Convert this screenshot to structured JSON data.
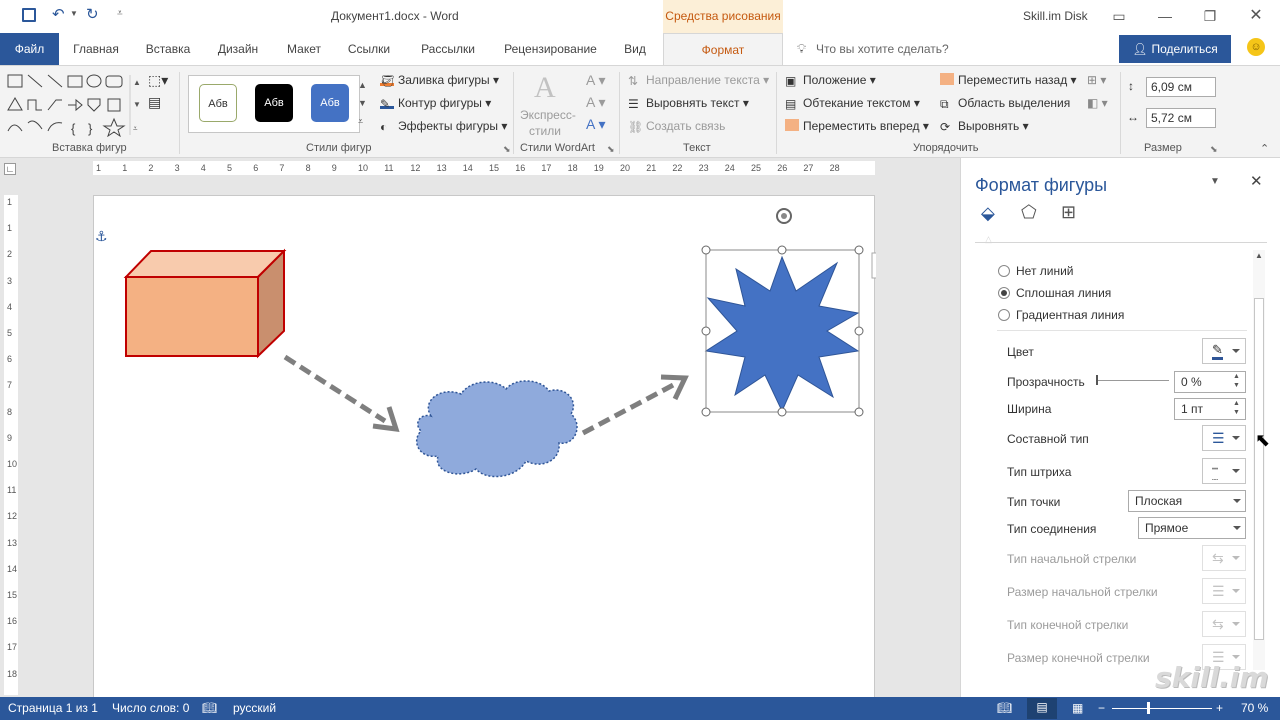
{
  "titlebar": {
    "doc_title": "Документ1.docx  -  Word",
    "context_tab": "Средства рисования",
    "account": "Skill.im Disk"
  },
  "tabs": [
    "Файл",
    "Главная",
    "Вставка",
    "Дизайн",
    "Макет",
    "Ссылки",
    "Рассылки",
    "Рецензирование",
    "Вид",
    "Формат"
  ],
  "search": {
    "placeholder": "Что вы хотите сделать?"
  },
  "share_label": "Поделиться",
  "ribbon": {
    "groups": {
      "insert_shapes": "Вставка фигур",
      "shape_styles": "Стили фигур",
      "wordart_styles": "Стили WordArt",
      "text": "Текст",
      "arrange": "Упорядочить",
      "size": "Размер"
    },
    "style_preset_label": "Абв",
    "fill": "Заливка фигуры",
    "outline": "Контур фигуры",
    "effects": "Эффекты фигуры",
    "express_1": "Экспресс-",
    "express_2": "стили",
    "text_direction": "Направление текста",
    "align_text": "Выровнять текст",
    "create_link": "Создать связь",
    "position": "Положение",
    "wrap_text": "Обтекание текстом",
    "bring_forward": "Переместить вперед",
    "send_backward": "Переместить назад",
    "selection_pane": "Область выделения",
    "align": "Выровнять",
    "height": "6,09 см",
    "width": "5,72 см"
  },
  "ruler_labels": [
    "1",
    "1",
    "2",
    "3",
    "4",
    "5",
    "6",
    "7",
    "8",
    "9",
    "10",
    "11",
    "12",
    "13",
    "14",
    "15",
    "16",
    "17",
    "18",
    "19",
    "20",
    "21",
    "22",
    "23",
    "24",
    "25",
    "26",
    "27",
    "28"
  ],
  "vruler_labels": [
    "1",
    "1",
    "2",
    "3",
    "4",
    "5",
    "6",
    "7",
    "8",
    "9",
    "10",
    "11",
    "12",
    "13",
    "14",
    "15",
    "16",
    "17",
    "18"
  ],
  "pane": {
    "title": "Формат фигуры",
    "no_line": "Нет линий",
    "solid_line": "Сплошная линия",
    "gradient_line": "Градиентная линия",
    "color": "Цвет",
    "transparency": "Прозрачность",
    "transparency_value": "0 %",
    "width": "Ширина",
    "width_value": "1 пт",
    "compound": "Составной тип",
    "dash": "Тип штриха",
    "cap": "Тип точки",
    "cap_value": "Плоская",
    "join": "Тип соединения",
    "join_value": "Прямое",
    "begin_arrow_type": "Тип начальной стрелки",
    "begin_arrow_size": "Размер начальной стрелки",
    "end_arrow_type": "Тип конечной стрелки",
    "end_arrow_size": "Размер конечной стрелки"
  },
  "status": {
    "page": "Страница 1 из 1",
    "words": "Число слов: 0",
    "lang": "русский",
    "zoom": "70 %"
  },
  "watermark": "skill.im",
  "colors": {
    "accent": "#2b579a",
    "context": "#c55a11",
    "cube_fill": "#f4b183",
    "cube_stroke": "#c00000",
    "cloud_fill": "#8faadc",
    "star_fill": "#4472c4",
    "arrow": "#7f7f7f"
  }
}
